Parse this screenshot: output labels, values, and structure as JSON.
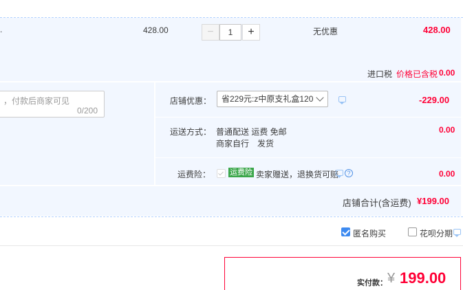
{
  "item": {
    "dot": ".",
    "unit_price": "428.00",
    "quantity": "1",
    "minus_symbol": "−",
    "plus_symbol": "+",
    "discount": "无优惠",
    "subtotal": "428.00"
  },
  "tax": {
    "label": "进口税",
    "note": "价格已含税",
    "value": "0.00"
  },
  "message": {
    "placeholder": "，付款后商家可见",
    "counter": "0/200"
  },
  "shop_discount": {
    "label": "店铺优惠：",
    "selected": "省229元:z中原支礼盒120",
    "value": "-229.00"
  },
  "shipping": {
    "label": "运送方式：",
    "line1": "普通配送 运费 免邮",
    "line2": "商家自行　发货",
    "value": "0.00"
  },
  "insurance": {
    "label": "运费险：",
    "badge": "运费险",
    "text": "卖家赠送，退换货可赔",
    "help": "?",
    "value": "0.00"
  },
  "shop_total": {
    "label": "店铺合计(含运费)",
    "value": "¥199.00"
  },
  "options": {
    "anonymous_label": "匿名购买",
    "anonymous_checked": true,
    "huabei_label": "花呗分期",
    "huabei_checked": false
  },
  "payment": {
    "label": "实付款：",
    "currency": "¥",
    "amount": "199.00"
  },
  "colors": {
    "accent_red": "#ff0036",
    "panel_bg": "#f2f7ff",
    "border_blue": "#b2d1ff",
    "checkbox_blue": "#3d8af0",
    "badge_green": "#3aa64a"
  }
}
